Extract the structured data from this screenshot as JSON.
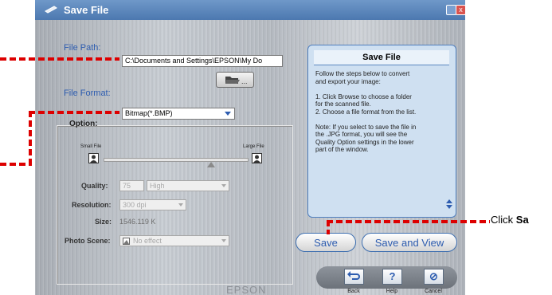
{
  "window": {
    "title": "Save File",
    "minimize_icon": "minimize-icon",
    "close_icon": "close-icon",
    "close_glyph": "x"
  },
  "file_path": {
    "label": "File Path:",
    "value": "C:\\Documents and Settings\\EPSON\\My Do",
    "browse_icon": "folder-open-icon"
  },
  "file_format": {
    "label": "File Format:",
    "value": "Bitmap(*.BMP)"
  },
  "option": {
    "title": "Option:",
    "small_file": "Small File",
    "large_file": "Large File",
    "quality": {
      "label": "Quality:",
      "number": "75",
      "value": "High"
    },
    "resolution": {
      "label": "Resolution:",
      "value": "300 dpi"
    },
    "size": {
      "label": "Size:",
      "value": "1546.119  K"
    },
    "photo_scene": {
      "label": "Photo Scene:",
      "value": "No effect"
    }
  },
  "info_panel": {
    "title": "Save File",
    "body": "Follow the steps below to convert\nand export your image:\n\n1. Click Browse to choose a folder\nfor the scanned file.\n2. Choose a file format from the list.\n\nNote: If you select to save the file in\nthe .JPG format, you will see the\nQuality Option settings in the lower\npart of the window."
  },
  "buttons": {
    "save": "Save",
    "save_and_view": "Save and View",
    "back": "Back",
    "help": "Help",
    "cancel": "Cancel",
    "help_glyph": "?",
    "cancel_glyph": "⊘"
  },
  "brand": "EPSON",
  "callout": {
    "prefix": "Click ",
    "bold": "Sa"
  },
  "colors": {
    "accent": "#2e5db0",
    "callout_red": "#dd0000",
    "titlebar": "#5a84bb"
  }
}
